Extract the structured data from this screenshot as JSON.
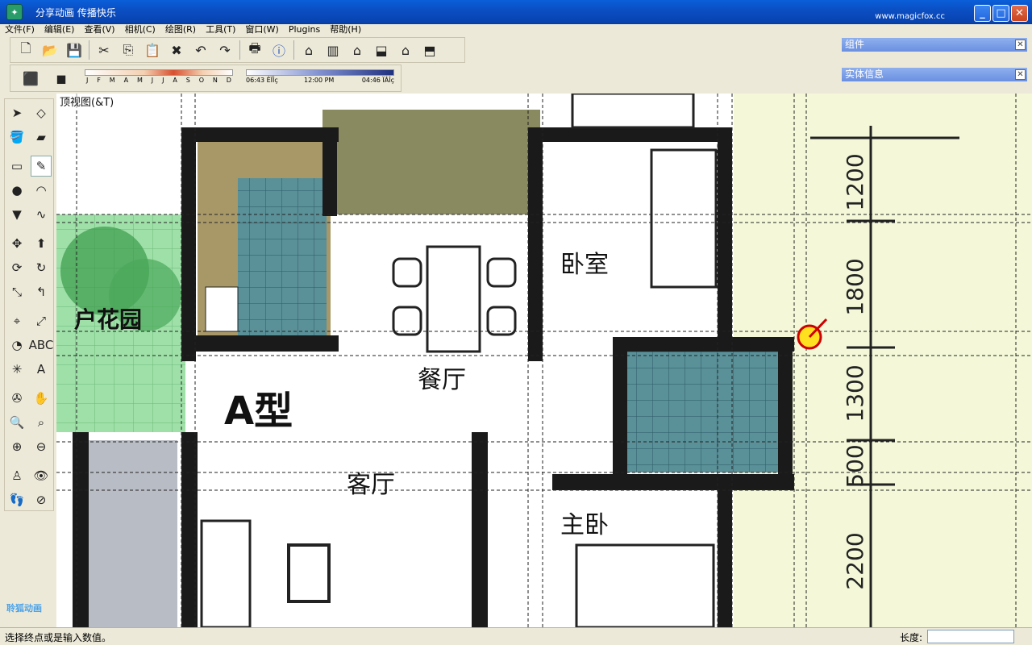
{
  "window": {
    "title": "分享动画  传播快乐",
    "url": "www.magicfox.cc",
    "icon": "app-logo-icon"
  },
  "menu": [
    "文件(F)",
    "编辑(E)",
    "查看(V)",
    "相机(C)",
    "绘图(R)",
    "工具(T)",
    "窗口(W)",
    "Plugins",
    "帮助(H)"
  ],
  "shadow": {
    "months": [
      "J",
      "F",
      "M",
      "A",
      "M",
      "J",
      "J",
      "A",
      "S",
      "O",
      "N",
      "D"
    ],
    "time_start": "06:43 ÊÏÎç",
    "time_mid": "12:00 PM",
    "time_end": "04:46 ÏÂÎç"
  },
  "panels": {
    "components": "组件",
    "entity_info": "实体信息"
  },
  "viewport": {
    "view_label": "顶视图(&T)"
  },
  "plan": {
    "room_labels": {
      "garden": "户花园",
      "dining": "餐厅",
      "bedroom": "卧室",
      "living": "客厅",
      "master": "主卧",
      "type": "A型"
    },
    "dimensions": [
      "1200",
      "1800",
      "1300",
      "500",
      "2200"
    ]
  },
  "status": {
    "prompt": "选择终点或是输入数值。",
    "length_label": "长度:"
  },
  "watermark": "聆狐动画"
}
